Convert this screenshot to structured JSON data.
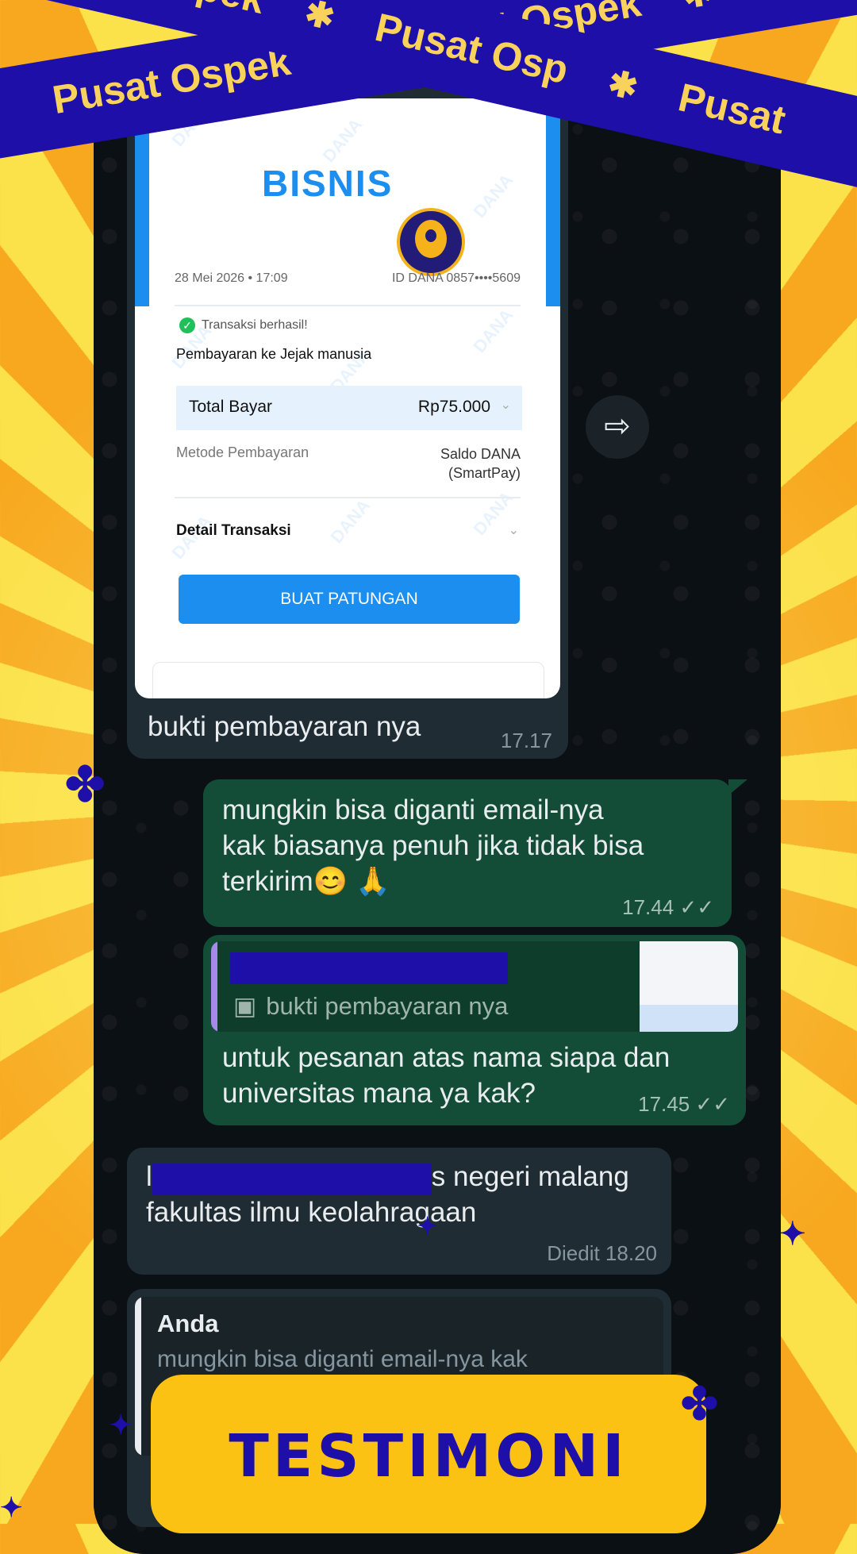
{
  "banners": {
    "tape_text": "Pusat Ospek",
    "tape_text_cut_top": "at Ospek",
    "tape_text_cut_mid": "Pusat Osp",
    "tape_text_cut_right": "Pusat",
    "separator": "✱"
  },
  "receipt": {
    "header_text": "BISNIS",
    "date": "28 Mei 2026 • 17:09",
    "account_id": "ID DANA 0857••••5609",
    "status": "Transaksi berhasil!",
    "payee": "Pembayaran ke Jejak manusia",
    "total_label": "Total Bayar",
    "total_value": "Rp75.000",
    "method_label": "Metode Pembayaran",
    "method_value_1": "Saldo DANA",
    "method_value_2": "(SmartPay)",
    "detail_label": "Detail Transaksi",
    "button_label": "BUAT PATUNGAN",
    "watermark": "DANA"
  },
  "messages": {
    "image_caption": "bukti pembayaran nya",
    "image_time": "17.17",
    "sent_1_line1": "mungkin bisa diganti email-nya",
    "sent_1_line2": "kak biasanya penuh jika tidak bisa",
    "sent_1_line3": "terkirim😊 🙏",
    "sent_1_time": "17.44 ✓✓",
    "quote_text": "bukti pembayaran nya",
    "sent_2_line1": "untuk pesanan atas nama siapa  dan",
    "sent_2_line2": "universitas mana ya kak?",
    "sent_2_time": "17.45 ✓✓",
    "recv_1_line1_start": "l",
    "recv_1_line1_end": "s negeri malang",
    "recv_1_line2": "fakultas ilmu keolahragaan",
    "recv_1_meta": "Diedit  18.20",
    "reply_author": "Anda",
    "reply_quote": "mungkin bisa diganti email-nya kak"
  },
  "footer": {
    "title": "TESTIMONI"
  },
  "icons": {
    "forward": "forward-icon",
    "image": "image-icon",
    "double_check": "double-check-icon"
  },
  "colors": {
    "brand_blue": "#1d0fa8",
    "brand_yellow": "#fbc213",
    "dana_blue": "#1b8ef0",
    "sent_bubble": "#144d37",
    "recv_bubble": "#1f2c33"
  }
}
